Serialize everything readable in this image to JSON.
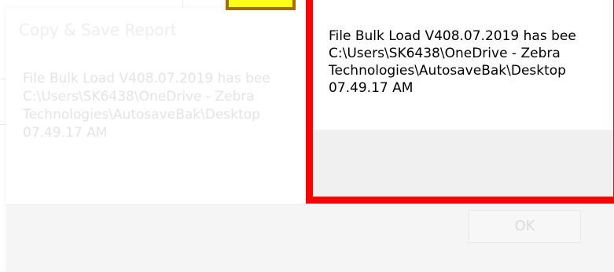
{
  "background_dialog": {
    "title": "Copy & Save Report",
    "message_lines": [
      "File Bulk Load V408.07.2019 has bee",
      "C:\\Users\\SK6438\\OneDrive - Zebra",
      "Technologies\\AutosaveBak\\Desktop",
      "07.49.17 AM"
    ],
    "ok_label": "OK"
  },
  "front_dialog": {
    "message_lines": [
      "File Bulk Load V408.07.2019 has bee",
      "C:\\Users\\SK6438\\OneDrive - Zebra",
      "Technologies\\AutosaveBak\\Desktop",
      "07.49.17 AM"
    ]
  },
  "colors": {
    "highlight_red": "#ff0000",
    "highlight_yellow": "#ffff1a",
    "highlight_yellow_border": "#a86b00"
  }
}
